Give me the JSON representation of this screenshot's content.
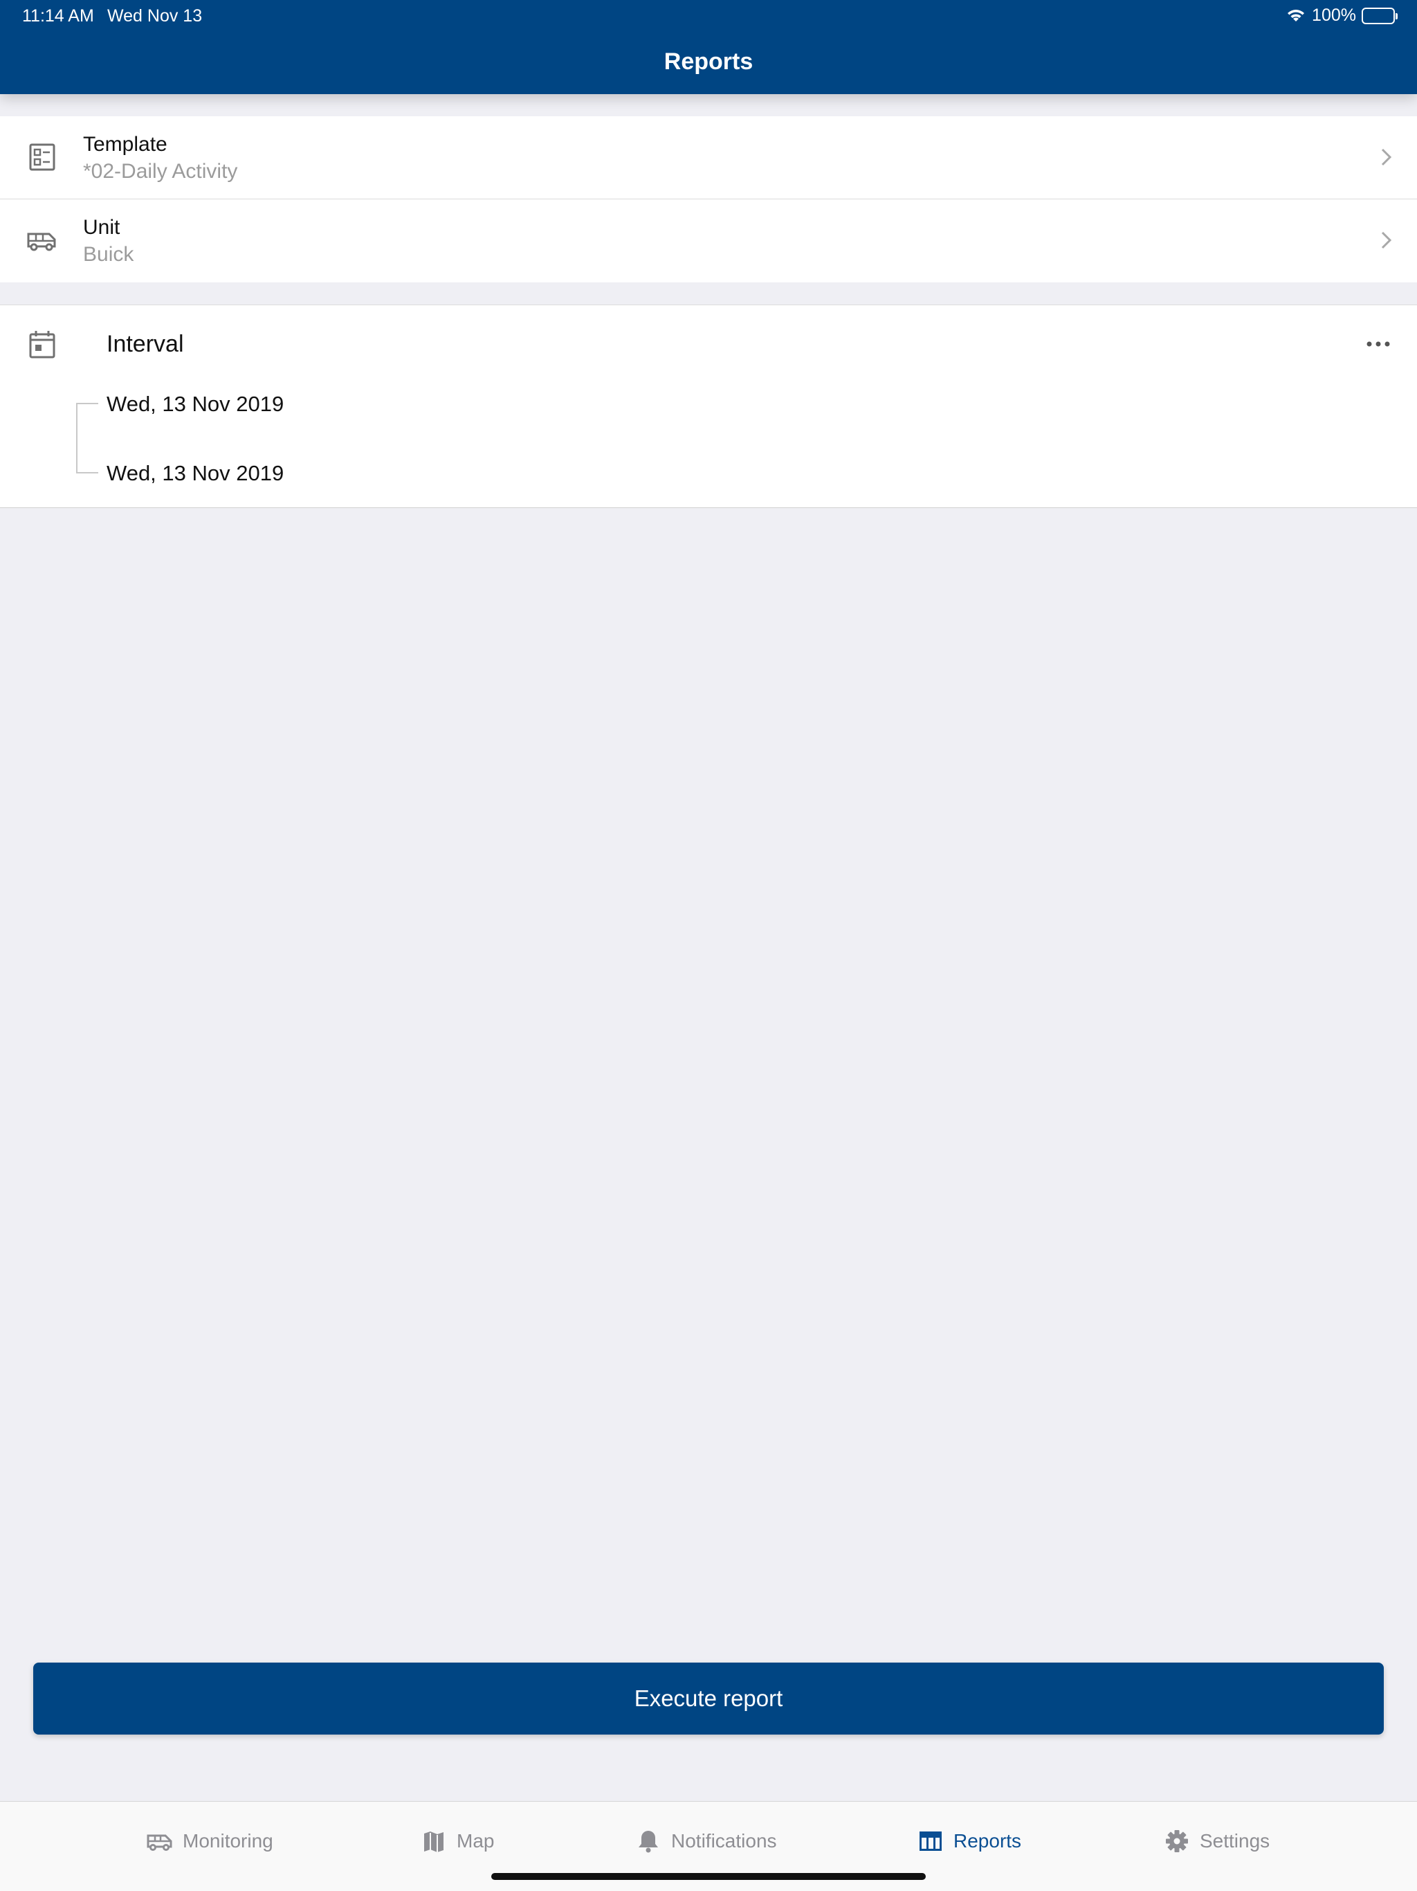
{
  "status_bar": {
    "time": "11:14 AM",
    "date": "Wed Nov 13",
    "battery": "100%"
  },
  "header": {
    "title": "Reports"
  },
  "rows": {
    "template": {
      "label": "Template",
      "value": "*02-Daily Activity"
    },
    "unit": {
      "label": "Unit",
      "value": "Buick"
    }
  },
  "interval": {
    "label": "Interval",
    "start": "Wed, 13 Nov 2019",
    "end": "Wed, 13 Nov 2019"
  },
  "execute": {
    "label": "Execute report"
  },
  "tabbar": {
    "items": [
      {
        "label": "Monitoring",
        "icon": "van-icon"
      },
      {
        "label": "Map",
        "icon": "map-icon"
      },
      {
        "label": "Notifications",
        "icon": "bell-icon"
      },
      {
        "label": "Reports",
        "icon": "table-icon",
        "active": true
      },
      {
        "label": "Settings",
        "icon": "gear-icon"
      }
    ]
  },
  "colors": {
    "brand": "#004583",
    "active_tab": "#0b4f93",
    "inactive_tab": "#8e8e93",
    "background": "#efeff4"
  }
}
